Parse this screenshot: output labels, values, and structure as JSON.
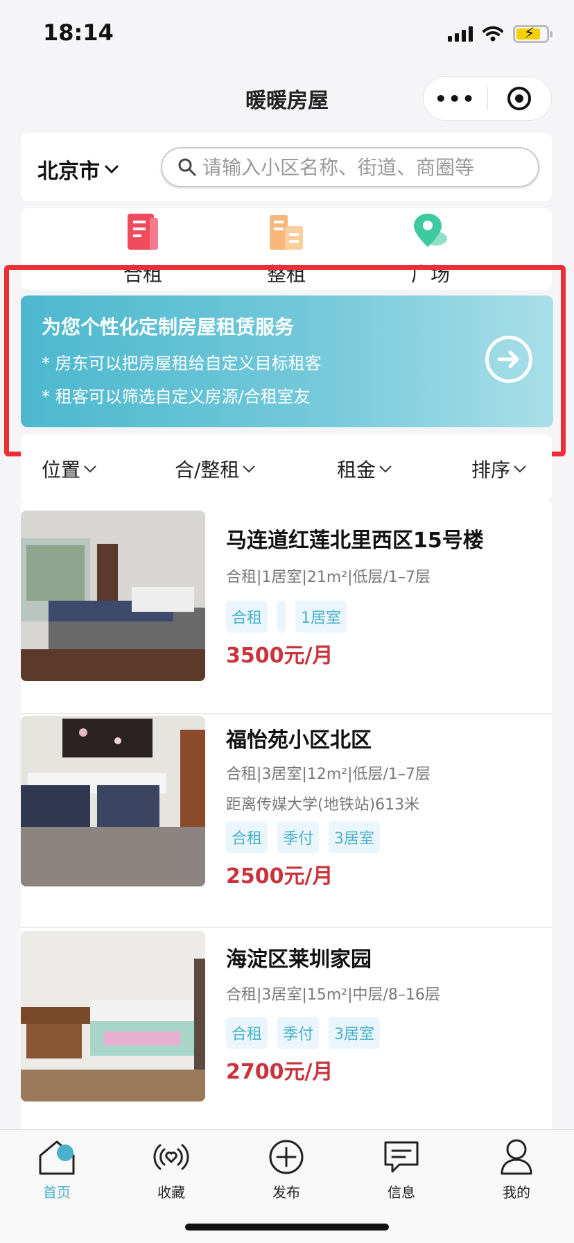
{
  "status_bar": {
    "time": "18:14"
  },
  "nav": {
    "title": "暖暖房屋"
  },
  "search": {
    "city": "北京市",
    "placeholder": "请输入小区名称、街道、商圈等"
  },
  "categories": [
    {
      "label": "合租",
      "icon": "building-doc-icon",
      "color": "#ef4b5d"
    },
    {
      "label": "整租",
      "icon": "office-building-icon",
      "color": "#f7b77a"
    },
    {
      "label": "广场",
      "icon": "map-pin-icon",
      "color": "#3fc9a0"
    }
  ],
  "promo": {
    "title": "为您个性化定制房屋租赁服务",
    "line1": "* 房东可以把房屋租给自定义目标租客",
    "line2": "* 租客可以筛选自定义房源/合租室友"
  },
  "filters": [
    {
      "label": "位置"
    },
    {
      "label": "合/整租"
    },
    {
      "label": "租金"
    },
    {
      "label": "排序"
    }
  ],
  "listings": [
    {
      "title": "马连道红莲北里西区15号楼",
      "meta": "合租|1居室|21m²|低层/1–7层",
      "distance": "",
      "tags": [
        "合租",
        "",
        "1居室"
      ],
      "price": "3500元/月"
    },
    {
      "title": "福怡苑小区北区",
      "meta": "合租|3居室|12m²|低层/1–7层",
      "distance": "距离传媒大学(地铁站)613米",
      "tags": [
        "合租",
        "季付",
        "3居室"
      ],
      "price": "2500元/月"
    },
    {
      "title": "海淀区莱圳家园",
      "meta": "合租|3居室|15m²|中层/8–16层",
      "distance": "",
      "tags": [
        "合租",
        "季付",
        "3居室"
      ],
      "price": "2700元/月"
    }
  ],
  "tabs": [
    {
      "label": "首页",
      "icon": "home-icon",
      "active": true
    },
    {
      "label": "收藏",
      "icon": "heart-signal-icon",
      "active": false
    },
    {
      "label": "发布",
      "icon": "plus-circle-icon",
      "active": false
    },
    {
      "label": "信息",
      "icon": "message-icon",
      "active": false
    },
    {
      "label": "我的",
      "icon": "user-icon",
      "active": false
    }
  ],
  "colors": {
    "accent": "#4ab0cd",
    "price": "#c8333c",
    "highlight_frame": "#ee2e36"
  }
}
